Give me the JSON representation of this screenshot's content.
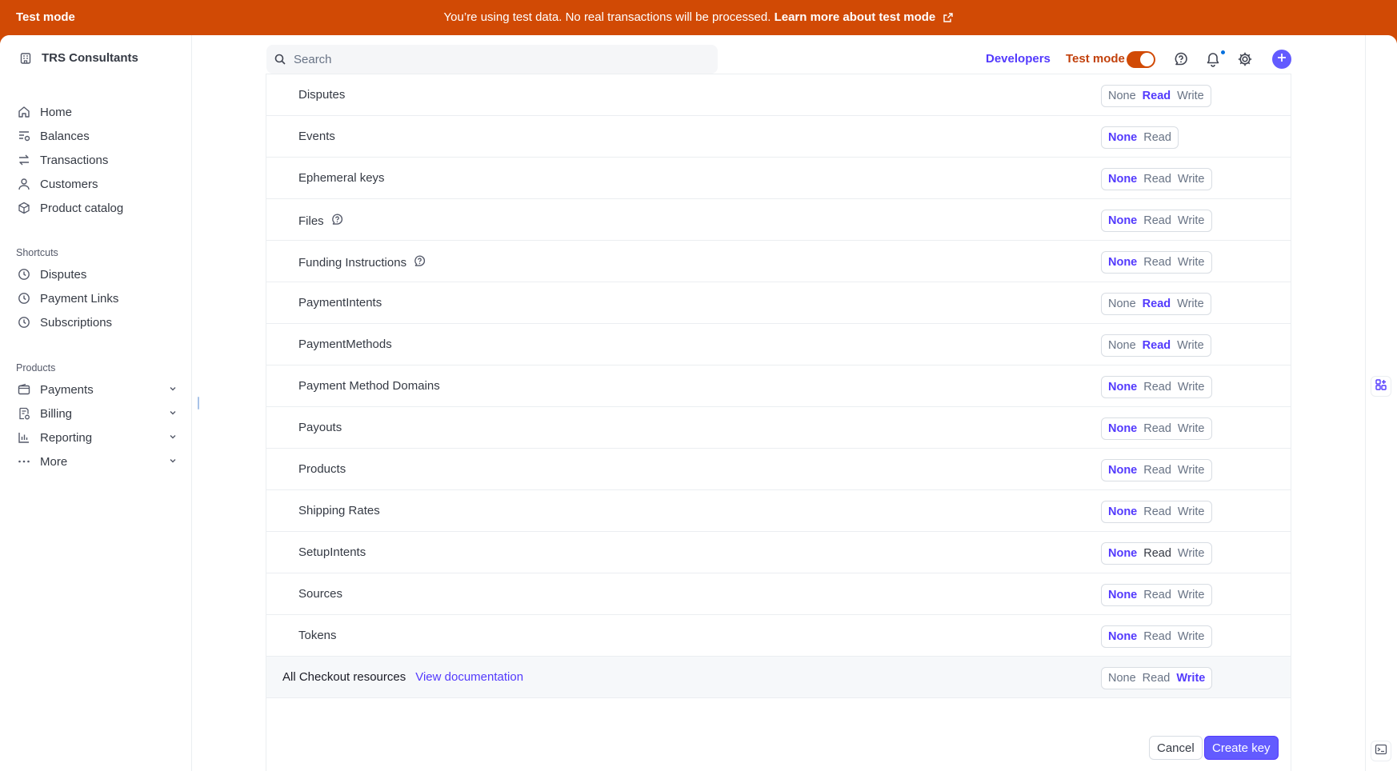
{
  "banner": {
    "label": "Test mode",
    "message": "You’re using test data. No real transactions will be processed.",
    "link": "Learn more about test mode"
  },
  "sidebar": {
    "account_name": "TRS Consultants",
    "main_items": [
      {
        "label": "Home",
        "icon": "home-icon"
      },
      {
        "label": "Balances",
        "icon": "balances-icon"
      },
      {
        "label": "Transactions",
        "icon": "transactions-icon"
      },
      {
        "label": "Customers",
        "icon": "customers-icon"
      },
      {
        "label": "Product catalog",
        "icon": "product-catalog-icon"
      }
    ],
    "shortcuts_title": "Shortcuts",
    "shortcuts": [
      {
        "label": "Disputes",
        "icon": "clock-icon"
      },
      {
        "label": "Payment Links",
        "icon": "clock-icon"
      },
      {
        "label": "Subscriptions",
        "icon": "clock-icon"
      }
    ],
    "products_title": "Products",
    "products": [
      {
        "label": "Payments",
        "icon": "wallet-icon"
      },
      {
        "label": "Billing",
        "icon": "billing-icon"
      },
      {
        "label": "Reporting",
        "icon": "chart-icon"
      },
      {
        "label": "More",
        "icon": "more-icon"
      }
    ]
  },
  "topbar": {
    "search_placeholder": "Search",
    "developers": "Developers",
    "test_mode": "Test mode",
    "test_mode_on": true
  },
  "permissions": [
    {
      "label": "Disputes",
      "options": [
        "None",
        "Read",
        "Write"
      ],
      "selected": "Read",
      "help": false
    },
    {
      "label": "Events",
      "options": [
        "None",
        "Read"
      ],
      "selected": "None",
      "help": false
    },
    {
      "label": "Ephemeral keys",
      "options": [
        "None",
        "Read",
        "Write"
      ],
      "selected": "None",
      "help": false
    },
    {
      "label": "Files",
      "options": [
        "None",
        "Read",
        "Write"
      ],
      "selected": "None",
      "help": true
    },
    {
      "label": "Funding Instructions",
      "options": [
        "None",
        "Read",
        "Write"
      ],
      "selected": "None",
      "help": true
    },
    {
      "label": "PaymentIntents",
      "options": [
        "None",
        "Read",
        "Write"
      ],
      "selected": "Read",
      "help": false
    },
    {
      "label": "PaymentMethods",
      "options": [
        "None",
        "Read",
        "Write"
      ],
      "selected": "Read",
      "help": false
    },
    {
      "label": "Payment Method Domains",
      "options": [
        "None",
        "Read",
        "Write"
      ],
      "selected": "None",
      "help": false
    },
    {
      "label": "Payouts",
      "options": [
        "None",
        "Read",
        "Write"
      ],
      "selected": "None",
      "help": false
    },
    {
      "label": "Products",
      "options": [
        "None",
        "Read",
        "Write"
      ],
      "selected": "None",
      "help": false
    },
    {
      "label": "Shipping Rates",
      "options": [
        "None",
        "Read",
        "Write"
      ],
      "selected": "None",
      "help": false
    },
    {
      "label": "SetupIntents",
      "options": [
        "None",
        "Read",
        "Write"
      ],
      "selected": "None",
      "help": false
    },
    {
      "label": "Sources",
      "options": [
        "None",
        "Read",
        "Write"
      ],
      "selected": "None",
      "help": false
    },
    {
      "label": "Tokens",
      "options": [
        "None",
        "Read",
        "Write"
      ],
      "selected": "None",
      "help": false
    }
  ],
  "checkout": {
    "label": "All Checkout resources",
    "link": "View documentation",
    "options": [
      "None",
      "Read",
      "Write"
    ],
    "selected": "Write"
  },
  "actions": {
    "cancel": "Cancel",
    "create": "Create key"
  }
}
